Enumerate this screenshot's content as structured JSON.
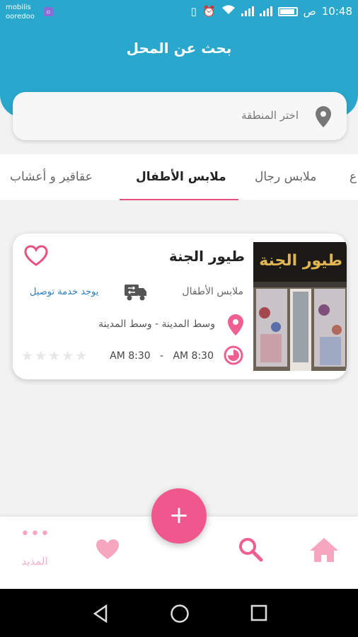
{
  "status_bar": {
    "carrier_top": "mobilis",
    "carrier_bottom": "ooredoo",
    "time": "10:48",
    "ampm": "ص"
  },
  "header": {
    "title": "بحث عن المحل"
  },
  "search": {
    "placeholder": "اختر المنطقة",
    "icon": "location-pin-icon"
  },
  "tabs": {
    "items": [
      {
        "label": "ع"
      },
      {
        "label": "ملابس رجال"
      },
      {
        "label": "ملابس الأطفال"
      },
      {
        "label": "عقاقير و أعشاب"
      }
    ],
    "active_index": 2
  },
  "shop_card": {
    "name": "طيور الجنة",
    "category": "ملابس الأطفال",
    "delivery": "يوجد خدمة توصيل",
    "location": "وسط المدينة -  وسط المدينة",
    "hours": "AM 8:30   -   AM 8:30",
    "rating": 0,
    "rating_max": 5,
    "photo_sign": "طيور الجنة"
  },
  "bottom_nav": {
    "more_label": "المذيد",
    "fab_label": "+"
  },
  "colors": {
    "primary": "#29a7cc",
    "accent": "#e8527f",
    "fab": "#f0588d",
    "nav_icon": "#f7a6c0"
  }
}
